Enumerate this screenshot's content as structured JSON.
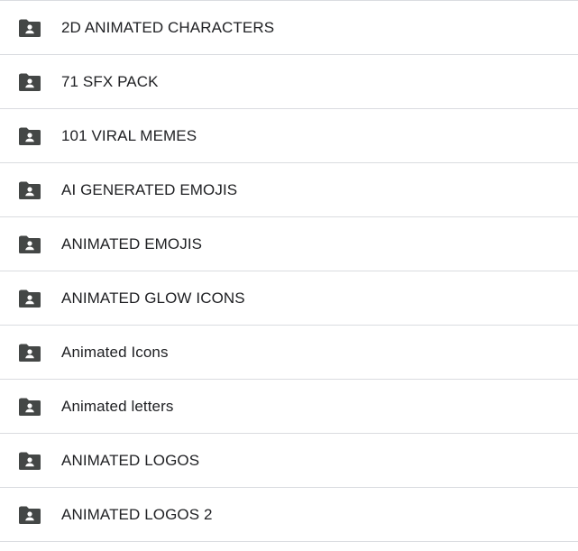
{
  "folders": [
    {
      "name": "2D ANIMATED CHARACTERS",
      "icon": "shared-folder-icon"
    },
    {
      "name": "71 SFX PACK",
      "icon": "shared-folder-icon"
    },
    {
      "name": "101 VIRAL MEMES",
      "icon": "shared-folder-icon"
    },
    {
      "name": "AI GENERATED EMOJIS",
      "icon": "shared-folder-icon"
    },
    {
      "name": "ANIMATED EMOJIS",
      "icon": "shared-folder-icon"
    },
    {
      "name": "ANIMATED GLOW ICONS",
      "icon": "shared-folder-icon"
    },
    {
      "name": "Animated Icons",
      "icon": "shared-folder-icon"
    },
    {
      "name": "Animated letters",
      "icon": "shared-folder-icon"
    },
    {
      "name": "ANIMATED LOGOS",
      "icon": "shared-folder-icon"
    },
    {
      "name": "ANIMATED LOGOS 2",
      "icon": "shared-folder-icon"
    }
  ],
  "colors": {
    "icon": "#444746",
    "text": "#202124",
    "divider": "#dadce0"
  }
}
